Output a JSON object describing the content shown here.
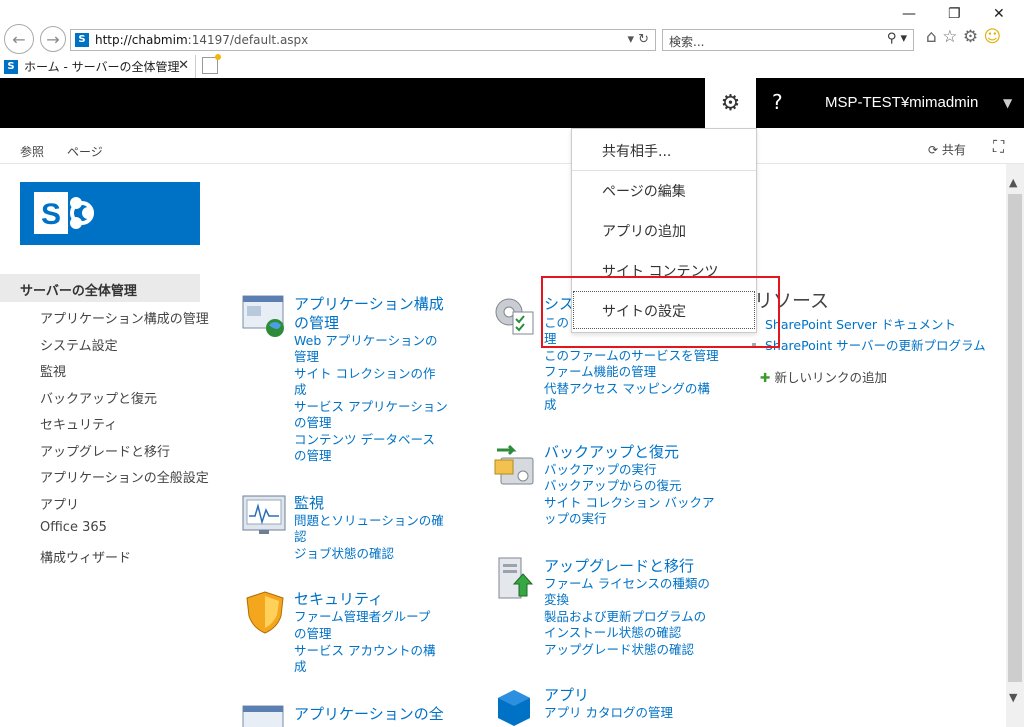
{
  "browser": {
    "url_host": "http://chabmim",
    "url_rest": ":14197/default.aspx",
    "search_placeholder": "検索...",
    "tab_title": "ホーム - サーバーの全体管理"
  },
  "suitebar": {
    "user": "MSP-TEST¥mimadmin",
    "help": "?"
  },
  "ribbon": {
    "tabs": [
      "参照",
      "ページ"
    ],
    "share": "共有"
  },
  "leftnav": {
    "current": "サーバーの全体管理",
    "items": [
      "アプリケーション構成の管理",
      "システム設定",
      "監視",
      "バックアップと復元",
      "セキュリティ",
      "アップグレードと移行",
      "アプリケーションの全般設定",
      "アプリ",
      "Office 365",
      "構成ウィザード"
    ]
  },
  "categories": {
    "appmgmt": {
      "title1": "アプリケーション構成",
      "title2": "の管理",
      "links": [
        "Web アプリケーションの",
        "管理",
        "サイト コレクションの作",
        "成",
        "サービス アプリケーション",
        "の管理",
        "コンテンツ データベース",
        "の管理"
      ]
    },
    "monitor": {
      "title": "監視",
      "links": [
        "問題とソリューションの確",
        "認",
        "ジョブ状態の確認"
      ]
    },
    "security": {
      "title": "セキュリティ",
      "links": [
        "ファーム管理者グループ",
        "の管理",
        "サービス アカウントの構",
        "成"
      ]
    },
    "general": {
      "title": "アプリケーションの全"
    },
    "system": {
      "title": "シス",
      "links": [
        "このフ",
        "理",
        "このファームのサービスを管理",
        "ファーム機能の管理",
        "代替アクセス マッピングの構",
        "成"
      ]
    },
    "backup": {
      "title": "バックアップと復元",
      "links": [
        "バックアップの実行",
        "バックアップからの復元",
        "サイト コレクション バックア",
        "ップの実行"
      ]
    },
    "upgrade": {
      "title": "アップグレードと移行",
      "links": [
        "ファーム ライセンスの種類の",
        "変換",
        "製品および更新プログラムの",
        "インストール状態の確認",
        "アップグレード状態の確認"
      ]
    },
    "apps": {
      "title": "アプリ",
      "links": [
        "アプリ カタログの管理"
      ]
    }
  },
  "resources": {
    "title": "リソース",
    "links": [
      "SharePoint Server ドキュメント",
      "SharePoint サーバーの更新プログラム"
    ],
    "add": "新しいリンクの追加"
  },
  "menu": {
    "items": [
      "共有相手...",
      "ページの編集",
      "アプリの追加",
      "サイト コンテンツ",
      "サイトの設定"
    ]
  },
  "colors": {
    "accent": "#0072c6",
    "highlight": "#e4151c"
  }
}
